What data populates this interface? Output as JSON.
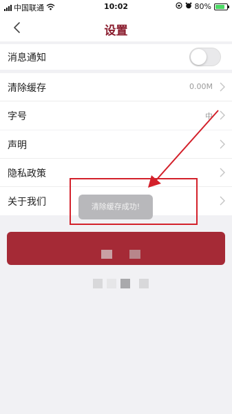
{
  "status_bar": {
    "carrier": "中国联通",
    "time": "10:02",
    "battery": "80%"
  },
  "nav": {
    "title": "设置"
  },
  "settings": {
    "notifications_label": "消息通知",
    "notifications_enabled": false,
    "clear_cache_label": "清除缓存",
    "clear_cache_value": "0.00M",
    "font_size_label": "字号",
    "font_size_value": "中",
    "statement_label": "声明",
    "privacy_label": "隐私政策",
    "about_label": "关于我们"
  },
  "toast": {
    "message": "清除缓存成功!"
  },
  "colors": {
    "brand": "#8a1d2e",
    "button": "#a52a36",
    "annotation": "#d3202a"
  }
}
